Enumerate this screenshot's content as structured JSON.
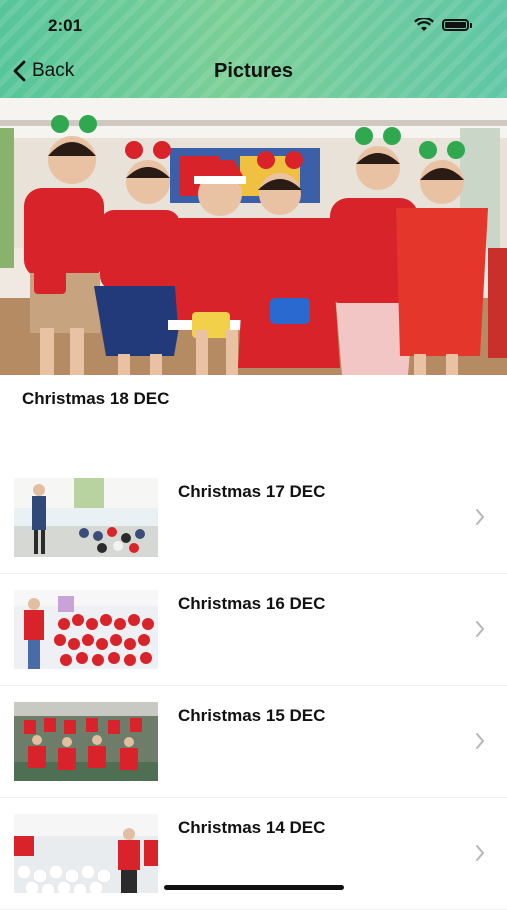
{
  "status_bar": {
    "time": "2:01"
  },
  "nav": {
    "back_label": "Back",
    "title": "Pictures"
  },
  "hero": {
    "caption": "Christmas 18 DEC"
  },
  "albums": [
    {
      "label": "Christmas 17 DEC"
    },
    {
      "label": "Christmas 16 DEC"
    },
    {
      "label": "Christmas 15 DEC"
    },
    {
      "label": "Christmas 14 DEC"
    }
  ],
  "colors": {
    "header_green": "#5fc6a6",
    "christmas_red": "#d9232a",
    "text": "#111111",
    "chevron": "#b5b5b5"
  }
}
